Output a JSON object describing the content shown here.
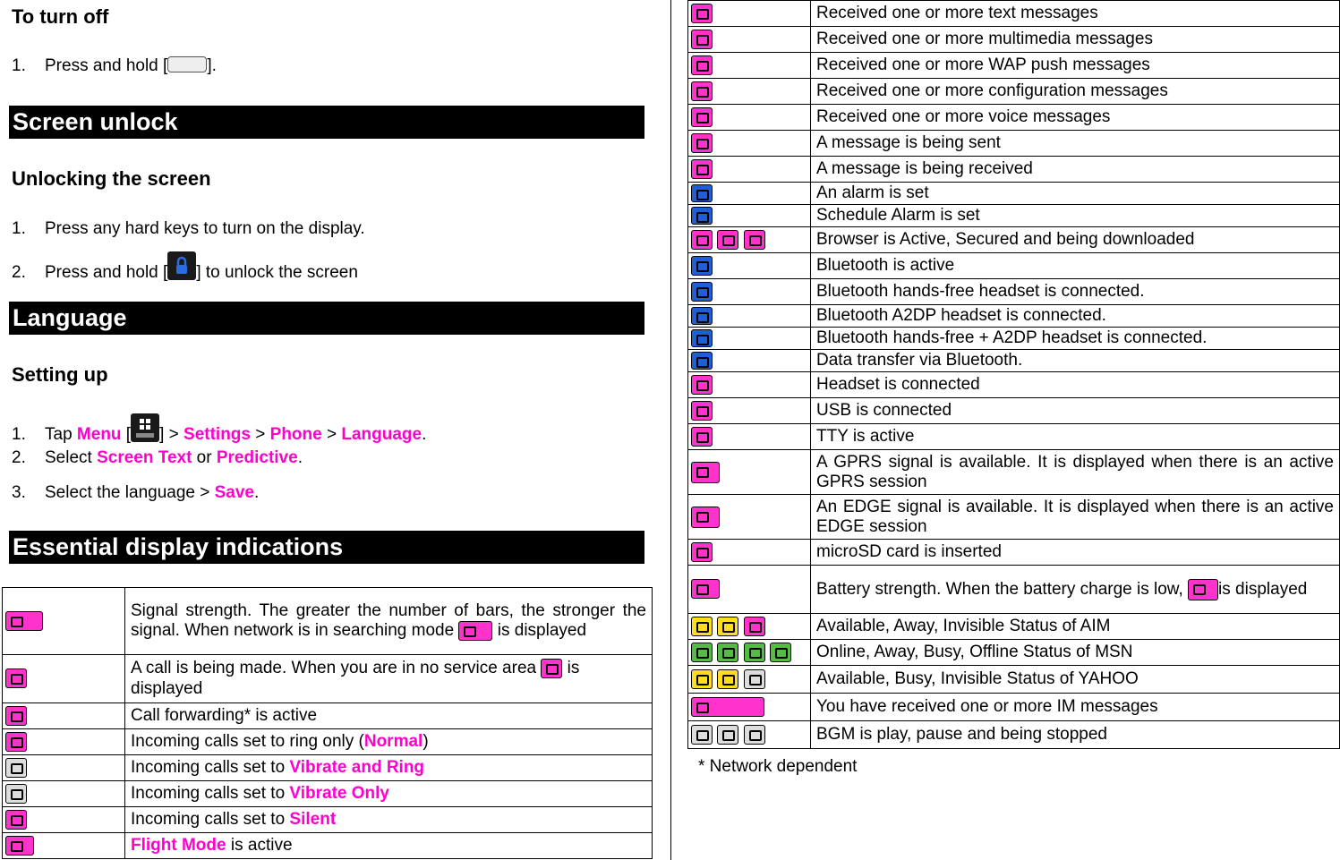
{
  "left": {
    "turn_off_heading": "To turn off",
    "turn_off_step1": {
      "num": "1.",
      "text_a": "Press and hold [",
      "text_b": "]."
    },
    "screen_unlock_bar": "Screen unlock",
    "unlock_heading": "Unlocking the screen",
    "unlock_steps": [
      {
        "num": "1.",
        "text": "Press any hard keys to turn on the display."
      },
      {
        "num": "2.",
        "text_a": "Press and hold [",
        "text_b": "] to unlock the screen"
      }
    ],
    "language_bar": "Language",
    "setting_heading": "Setting up",
    "setting_step1": {
      "num": "1.",
      "tap": "Tap ",
      "menu": "Menu",
      "br_open": " [",
      "br_close": "] > ",
      "settings": "Settings",
      "gt1": " > ",
      "phone": "Phone",
      "gt2": " > ",
      "language": "Language",
      "end": "."
    },
    "setting_step2": {
      "num": "2.",
      "select": "Select ",
      "screen_text": "Screen Text",
      "or": " or ",
      "predictive": "Predictive",
      "end": "."
    },
    "setting_step3": {
      "num": "3.",
      "text": "Select the language > ",
      "save": "Save",
      "end": "."
    },
    "essential_bar": "Essential display indications",
    "table": [
      {
        "text_a": "Signal strength. The greater the number of bars, the stronger the signal. When network is in searching mode ",
        "text_b": " is displayed"
      },
      {
        "text_a": "A call is being made. When you are in no service area ",
        "text_b": " is displayed"
      },
      {
        "text": "Call forwarding* is active"
      },
      {
        "text_a": "Incoming calls set to ring only (",
        "pink": "Normal",
        "text_b": ")"
      },
      {
        "text_a": "Incoming calls set to ",
        "pink": "Vibrate and Ring"
      },
      {
        "text_a": "Incoming calls set to ",
        "pink": "Vibrate Only"
      },
      {
        "text_a": "Incoming calls set to ",
        "pink": "Silent"
      },
      {
        "pink": "Flight Mode",
        "text_b": " is active"
      }
    ]
  },
  "right": {
    "table": [
      {
        "text": "Received one or more text messages"
      },
      {
        "text": "Received one or more multimedia messages"
      },
      {
        "text": "Received one or more WAP push messages"
      },
      {
        "text": "Received one or more configuration messages"
      },
      {
        "text": "Received one or more voice messages"
      },
      {
        "text": "A message is being sent"
      },
      {
        "text": "A message is being received"
      },
      {
        "text": "An alarm is set"
      },
      {
        "text": "Schedule Alarm is set"
      },
      {
        "text": "Browser is Active, Secured and being downloaded"
      },
      {
        "text": "Bluetooth is active"
      },
      {
        "text": "Bluetooth hands-free headset is connected."
      },
      {
        "text": "Bluetooth A2DP headset is connected."
      },
      {
        "text": "Bluetooth hands-free + A2DP headset is connected."
      },
      {
        "text": "Data transfer via Bluetooth."
      },
      {
        "text": "Headset is connected"
      },
      {
        "text": "USB is connected"
      },
      {
        "text": "TTY is active"
      },
      {
        "text": "A GPRS signal is available. It is displayed when there is an active GPRS session"
      },
      {
        "text": "An EDGE signal is available. It is displayed when there is an active EDGE session"
      },
      {
        "text": "microSD card is inserted"
      },
      {
        "text_a": "Battery strength. When the battery charge is low, ",
        "text_b": "is displayed"
      },
      {
        "text": "Available, Away, Invisible Status of AIM"
      },
      {
        "text": "Online, Away, Busy, Offline Status of MSN"
      },
      {
        "text": "Available, Busy, Invisible Status of YAHOO"
      },
      {
        "text": "You have received one or more IM messages"
      },
      {
        "text": "BGM is play, pause and being stopped"
      }
    ],
    "note": "* Network dependent"
  },
  "colors": {
    "accent": "#ff00cc",
    "bar_bg": "#000000",
    "icon_pink": "#ff33cc",
    "icon_blue": "#1f5fd6"
  },
  "icons": [
    "power-lock-key-icon",
    "unlock-key-icon",
    "menu-key-icon",
    "signal-icon",
    "call-icon",
    "message-icon",
    "bluetooth-icon",
    "battery-icon"
  ]
}
